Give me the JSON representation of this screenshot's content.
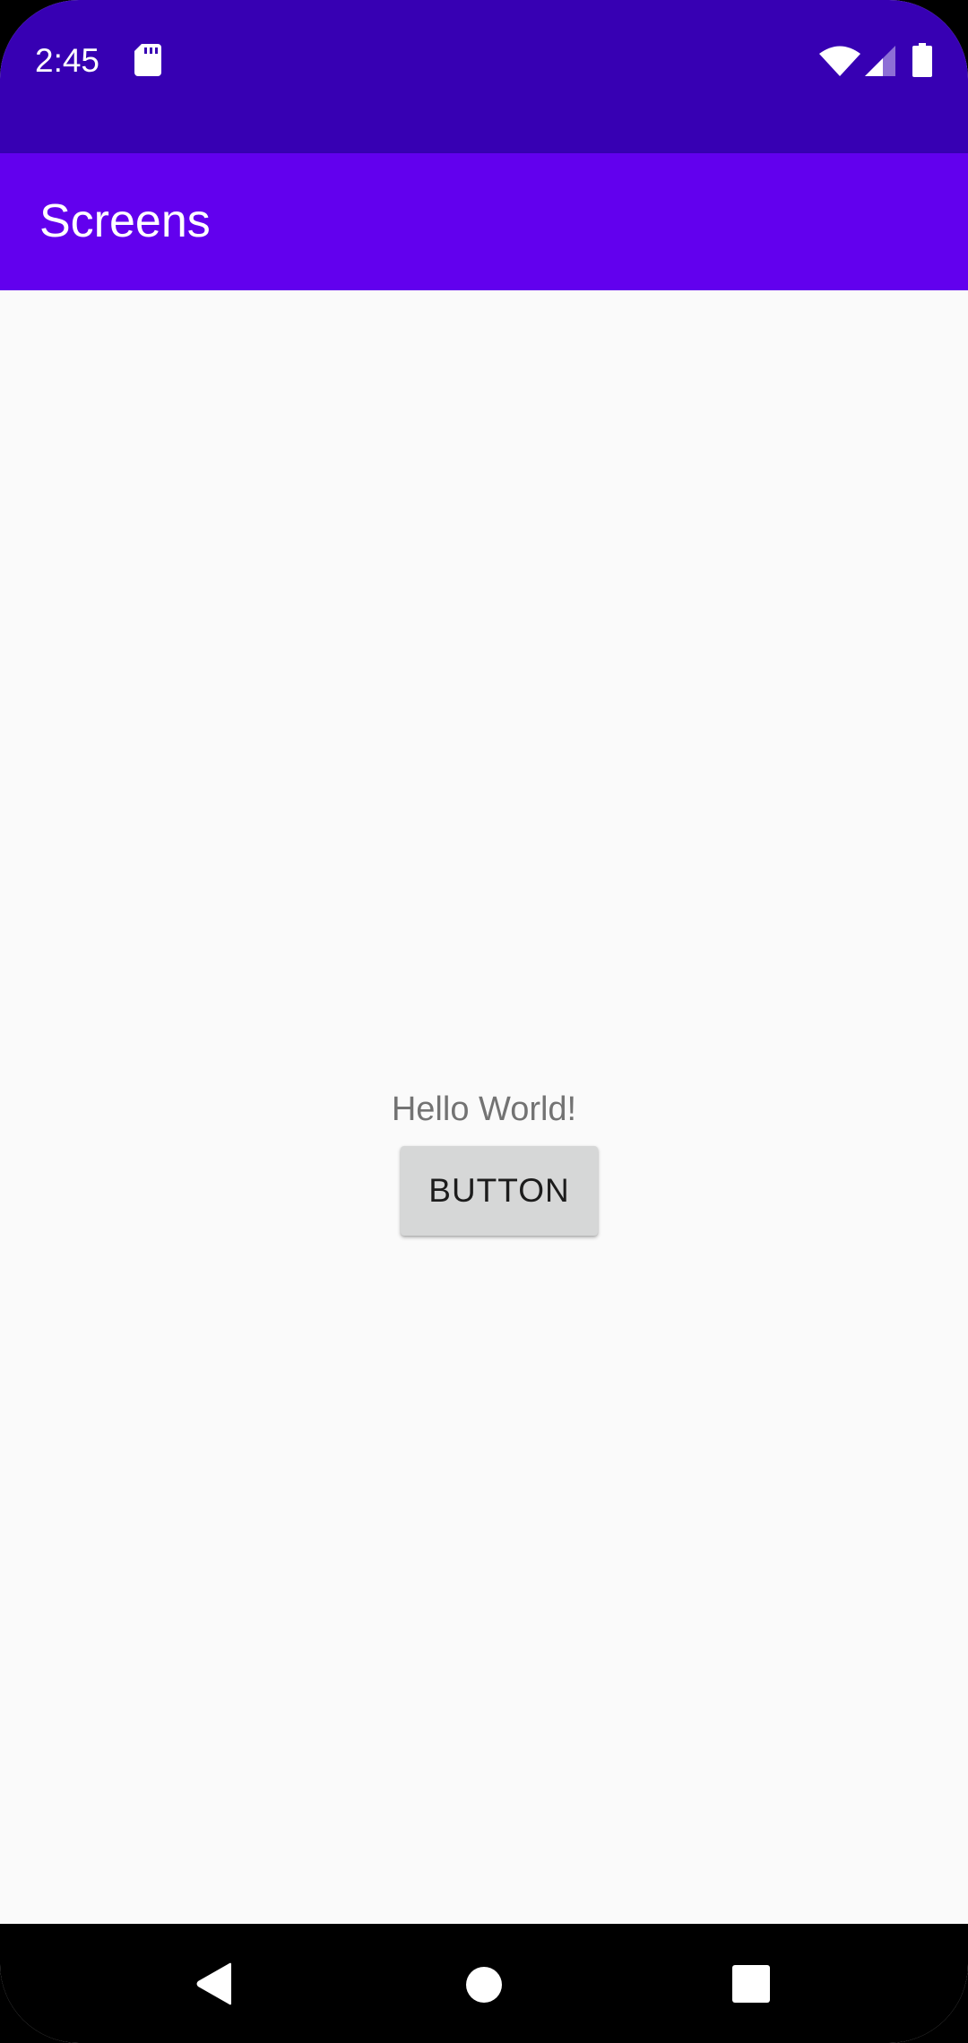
{
  "status_bar": {
    "time": "2:45",
    "icons": [
      "sd-card-icon",
      "wifi-icon",
      "cellular-signal-icon",
      "battery-icon"
    ]
  },
  "app_bar": {
    "title": "Screens"
  },
  "content": {
    "greeting": "Hello World!",
    "button_label": "BUTTON"
  },
  "nav_bar": {
    "icons": [
      "back-icon",
      "home-icon",
      "recents-icon"
    ]
  },
  "colors": {
    "status_bar": "#3700b3",
    "app_bar": "#6200ee",
    "background": "#fafafa",
    "button": "#d6d7d7",
    "text_secondary": "#737373"
  }
}
